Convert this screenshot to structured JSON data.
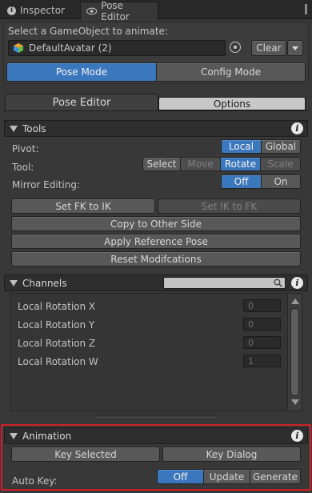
{
  "window_tabs": {
    "inspector": "Inspector",
    "pose_editor": "Pose Editor"
  },
  "select_prompt": "Select a GameObject to animate:",
  "object_field": {
    "value": "DefaultAvatar (2)"
  },
  "clear_label": "Clear",
  "modes": {
    "pose": "Pose Mode",
    "config": "Config Mode",
    "selected": "pose"
  },
  "sub_tabs": {
    "pose_editor": "Pose Editor",
    "options": "Options"
  },
  "tools": {
    "title": "Tools",
    "pivot_label": "Pivot:",
    "pivot_options": [
      "Local",
      "Global"
    ],
    "pivot_selected": "Local",
    "tool_label": "Tool:",
    "tool_options": [
      "Select",
      "Move",
      "Rotate",
      "Scale"
    ],
    "tool_selected": "Rotate",
    "mirror_label": "Mirror Editing:",
    "mirror_options": [
      "Off",
      "On"
    ],
    "mirror_selected": "Off",
    "fk_to_ik": "Set FK to IK",
    "ik_to_fk": "Set IK to FK",
    "copy_other_side": "Copy to Other Side",
    "apply_ref_pose": "Apply Reference Pose",
    "reset_mods": "Reset Modifcations"
  },
  "channels": {
    "title": "Channels",
    "search_placeholder": "",
    "rows": [
      {
        "label": "Local Rotation X",
        "value": "0"
      },
      {
        "label": "Local Rotation Y",
        "value": "0"
      },
      {
        "label": "Local Rotation Z",
        "value": "0"
      },
      {
        "label": "Local Rotation W",
        "value": "1"
      }
    ]
  },
  "animation": {
    "title": "Animation",
    "key_selected": "Key Selected",
    "key_dialog": "Key Dialog",
    "auto_key_label": "Auto Key:",
    "auto_key_options": [
      "Off",
      "Update",
      "Generate"
    ],
    "auto_key_selected": "Off"
  },
  "colors": {
    "accent": "#3b77bd",
    "highlight_border": "#d0212a"
  }
}
